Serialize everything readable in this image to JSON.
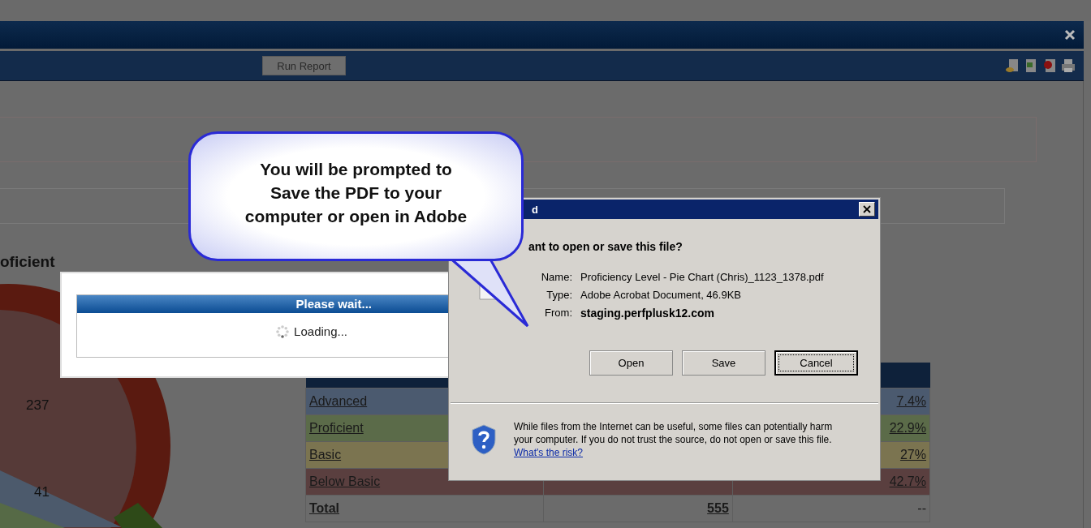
{
  "toolbar": {
    "run_button": "Run Report"
  },
  "section": {
    "heading": "oficient"
  },
  "pie_labels": [
    "237",
    "41"
  ],
  "table": {
    "rows": [
      {
        "kind": "level",
        "label": "Advanced",
        "percent": "7.4%",
        "color": "#4b5a6f"
      },
      {
        "kind": "level",
        "label": "Proficient",
        "percent": "22.9%",
        "color": "#5b6b49"
      },
      {
        "kind": "level",
        "label": "Basic",
        "percent": "27%",
        "color": "#7b7450"
      },
      {
        "kind": "level",
        "label": "Below Basic",
        "percent": "42.7%",
        "color": "#5a3f3f"
      },
      {
        "kind": "total",
        "label": "Total",
        "count": "555",
        "percent": "--",
        "color": "#6b6b6b"
      }
    ]
  },
  "loading": {
    "title": "Please wait...",
    "message": "Loading..."
  },
  "callout": {
    "lines": [
      "You will be prompted to",
      "Save the PDF to your",
      "computer or open in Adobe"
    ]
  },
  "dialog": {
    "title": "d",
    "question": "ant to open or save this file?",
    "fields": [
      {
        "label": "Name:",
        "value": "Proficiency Level - Pie Chart (Chris)_1123_1378.pdf",
        "bold": false
      },
      {
        "label": "Type:",
        "value": "Adobe Acrobat Document, 46.9KB",
        "bold": false
      },
      {
        "label": "From:",
        "value": "staging.perfplusk12.com",
        "bold": true
      }
    ],
    "buttons": [
      {
        "label": "Open",
        "focused": false
      },
      {
        "label": "Save",
        "focused": false
      },
      {
        "label": "Cancel",
        "focused": true
      }
    ],
    "warning": "While files from the Internet can be useful, some files can potentially harm your computer. If you do not trust the source, do not open or save this file.",
    "risk_link": "What's the risk?"
  }
}
